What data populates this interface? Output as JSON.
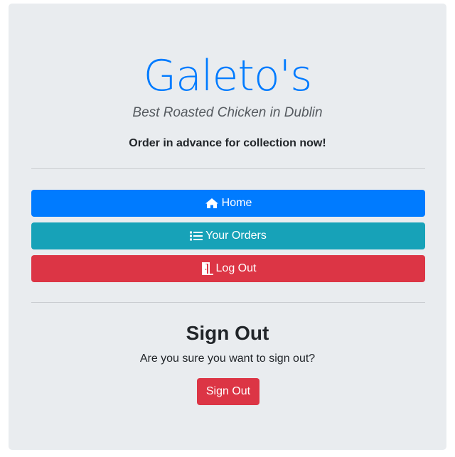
{
  "header": {
    "brand": "Galeto's",
    "tagline": "Best Roasted Chicken in Dublin",
    "cta": "Order in advance for collection now!"
  },
  "nav": {
    "buttons": [
      {
        "label": "Home",
        "icon": "home-icon",
        "color": "#007bff"
      },
      {
        "label": "Your Orders",
        "icon": "list-icon",
        "color": "#17a2b8"
      },
      {
        "label": "Log Out",
        "icon": "door-exit-icon",
        "color": "#dc3545"
      }
    ]
  },
  "signout": {
    "title": "Sign Out",
    "message": "Are you sure you want to sign out?",
    "button_label": "Sign Out"
  },
  "colors": {
    "background": "#e9ecef",
    "brand": "#007bff",
    "danger": "#dc3545",
    "info": "#17a2b8"
  }
}
